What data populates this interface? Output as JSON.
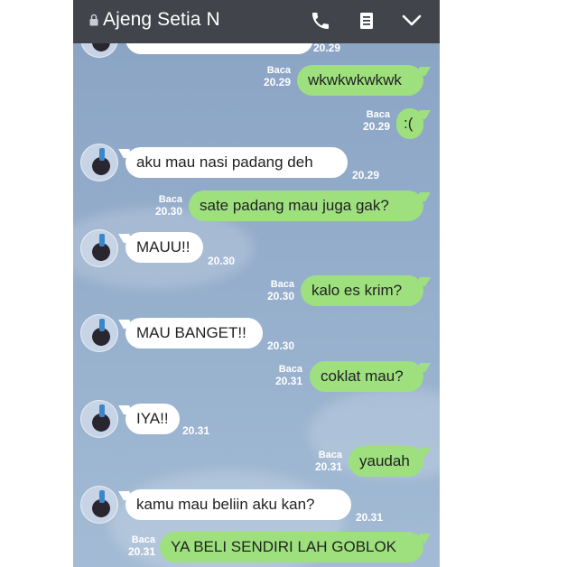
{
  "header": {
    "contact_name": "Ajeng Setia N"
  },
  "read_label": "Baca",
  "messages": [
    {
      "text": "",
      "time": "20.29"
    },
    {
      "text": "wkwkwkwkwk",
      "time": "20.29"
    },
    {
      "text": ":(",
      "time": "20.29"
    },
    {
      "text": "aku mau nasi padang deh",
      "time": "20.29"
    },
    {
      "text": "sate padang mau juga gak?",
      "time": "20.30"
    },
    {
      "text": "MAUU!!",
      "time": "20.30"
    },
    {
      "text": "kalo es krim?",
      "time": "20.30"
    },
    {
      "text": "MAU BANGET!!",
      "time": "20.30"
    },
    {
      "text": "coklat mau?",
      "time": "20.31"
    },
    {
      "text": "IYA!!",
      "time": "20.31"
    },
    {
      "text": "yaudah",
      "time": "20.31"
    },
    {
      "text": "kamu mau beliin aku kan?",
      "time": "20.31"
    },
    {
      "text": "YA BELI SENDIRI LAH GOBLOK",
      "time": "20.31"
    }
  ]
}
